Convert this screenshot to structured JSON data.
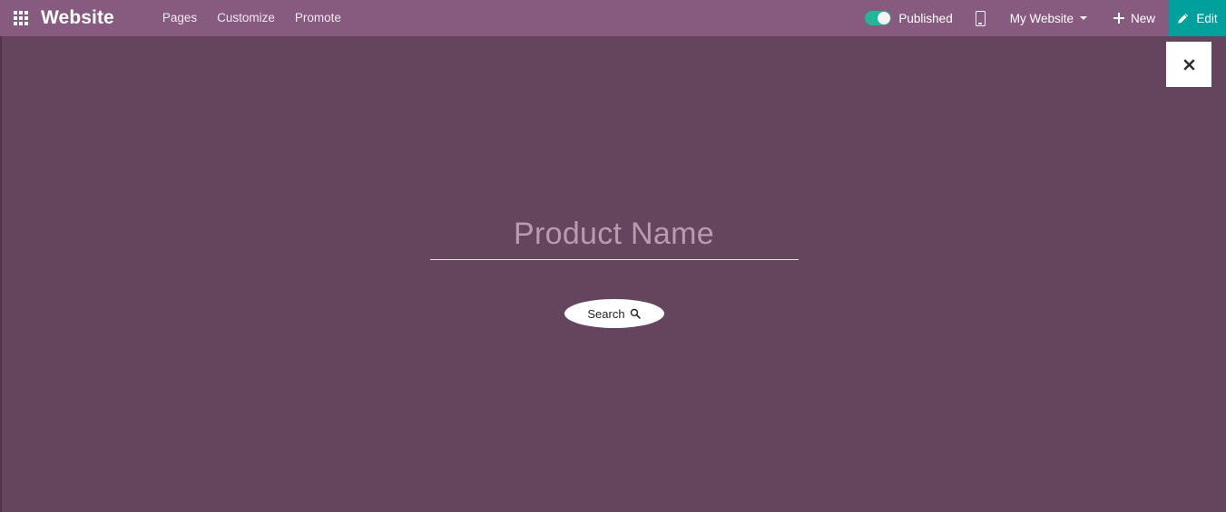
{
  "topbar": {
    "apps_icon": "apps-grid-icon",
    "brand": "Website",
    "menu": [
      {
        "label": "Pages",
        "name": "nav-item-pages"
      },
      {
        "label": "Customize",
        "name": "nav-item-customize"
      },
      {
        "label": "Promote",
        "name": "nav-item-promote"
      }
    ],
    "publish": {
      "label": "Published",
      "state": "on",
      "toggle_color": "#21b799"
    },
    "mobile_preview_icon": "mobile-phone-icon",
    "site_selector": {
      "label": "My Website",
      "caret_icon": "chevron-down-icon"
    },
    "new_button": {
      "label": "New",
      "icon": "plus-icon"
    },
    "edit_button": {
      "label": "Edit",
      "icon": "pencil-icon",
      "color": "#00a09d"
    }
  },
  "page": {
    "background_color": "#64455d",
    "close_button": {
      "icon": "close-x-icon",
      "label": "×"
    },
    "search": {
      "value": "",
      "placeholder": "Product Name",
      "button_label": "Search",
      "button_icon": "search-magnifier-icon"
    }
  }
}
